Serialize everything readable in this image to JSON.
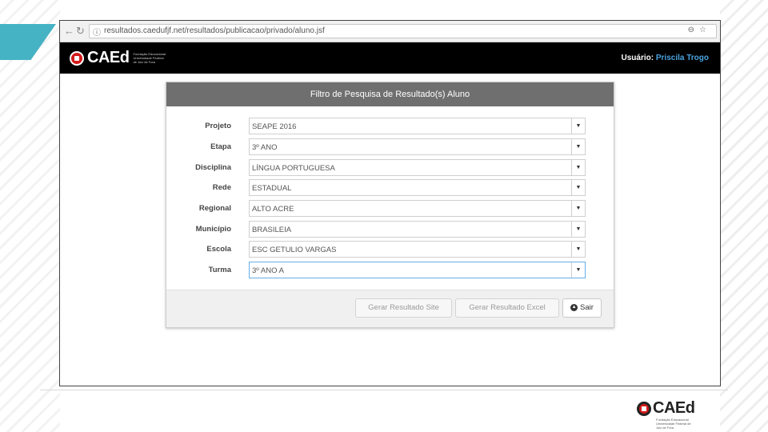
{
  "browser": {
    "url": "resultados.caedufjf.net/resultados/publicacao/privado/aluno.jsf"
  },
  "header": {
    "logo_text": "CAEd",
    "logo_sub": "Fundação Educacional Universidade Federal de Juiz de Fora",
    "user_label": "Usuário:",
    "user_name": "Priscila Trogo"
  },
  "panel": {
    "title": "Filtro de Pesquisa de Resultado(s) Aluno",
    "fields": [
      {
        "label": "Projeto",
        "value": "SEAPE 2016"
      },
      {
        "label": "Etapa",
        "value": "3º ANO"
      },
      {
        "label": "Disciplina",
        "value": "LÍNGUA PORTUGUESA"
      },
      {
        "label": "Rede",
        "value": "ESTADUAL"
      },
      {
        "label": "Regional",
        "value": "ALTO ACRE"
      },
      {
        "label": "Município",
        "value": "BRASILEIA"
      },
      {
        "label": "Escola",
        "value": "ESC GETULIO VARGAS"
      },
      {
        "label": "Turma",
        "value": "3º ANO A"
      }
    ],
    "buttons": {
      "site": "Gerar Resultado Site",
      "excel": "Gerar Resultado Excel",
      "exit": "Sair"
    }
  },
  "footer": {
    "logo_text": "CAEd",
    "logo_sub": "Fundação Educacional Universidade Federal de Juiz de Fora"
  },
  "colors": {
    "accent": "#46b3c4",
    "header_bg": "#000000",
    "panel_head": "#6f6f6f",
    "user_name": "#4aa3df",
    "brand_red": "#d21a1a"
  }
}
